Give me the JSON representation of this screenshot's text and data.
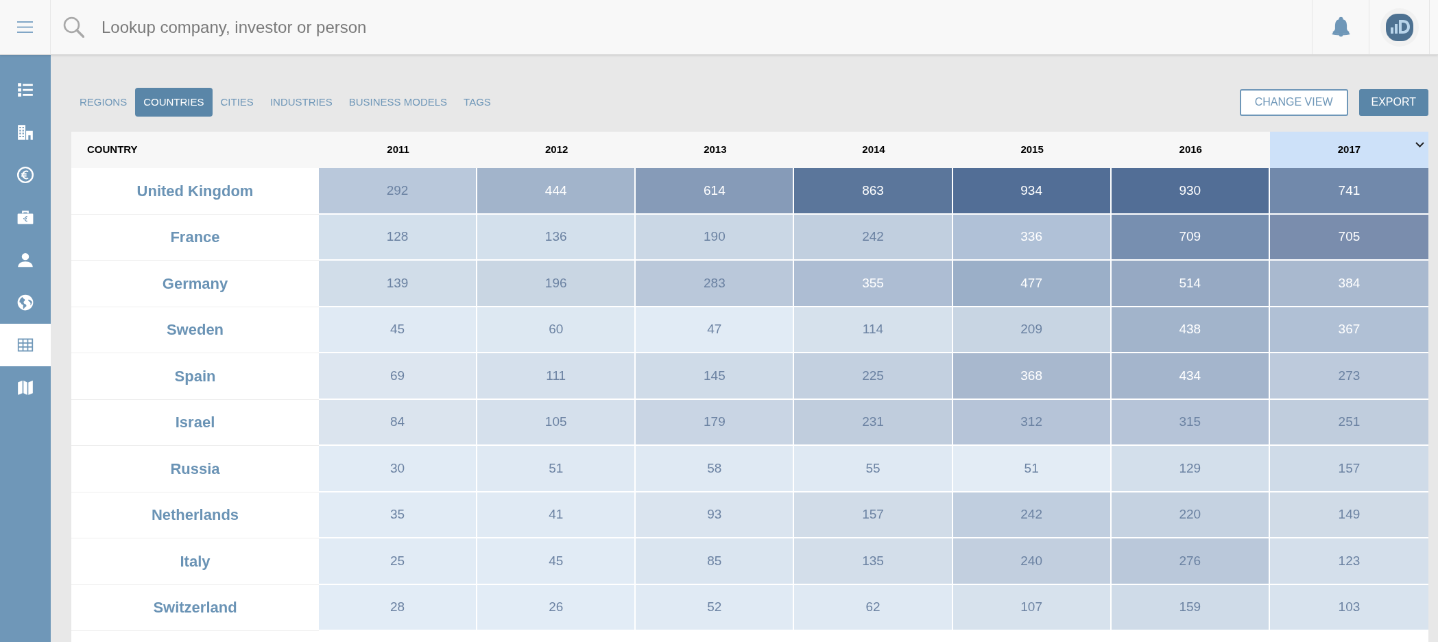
{
  "search": {
    "placeholder": "Lookup company, investor or person"
  },
  "sidebar": {
    "items": [
      {
        "selected": false
      },
      {
        "selected": false
      },
      {
        "selected": false
      },
      {
        "selected": false
      },
      {
        "selected": false
      },
      {
        "selected": false
      },
      {
        "selected": true
      },
      {
        "selected": false
      }
    ]
  },
  "tabs": [
    {
      "label": "REGIONS",
      "selected": false
    },
    {
      "label": "COUNTRIES",
      "selected": true
    },
    {
      "label": "CITIES",
      "selected": false
    },
    {
      "label": "INDUSTRIES",
      "selected": false
    },
    {
      "label": "BUSINESS MODELS",
      "selected": false
    },
    {
      "label": "TAGS",
      "selected": false
    }
  ],
  "buttons": [
    {
      "label": "CHANGE VIEW",
      "kind": "outline"
    },
    {
      "label": "EXPORT",
      "kind": "filled"
    }
  ],
  "table": {
    "columns": [
      {
        "label": "COUNTRY",
        "selected": false
      },
      {
        "label": "2011",
        "selected": false
      },
      {
        "label": "2012",
        "selected": false
      },
      {
        "label": "2013",
        "selected": false
      },
      {
        "label": "2014",
        "selected": false
      },
      {
        "label": "2015",
        "selected": false
      },
      {
        "label": "2016",
        "selected": false
      },
      {
        "label": "2017",
        "selected": true
      }
    ],
    "rows": [
      {
        "cells": [
          {
            "kind": "country",
            "value": "United Kingdom"
          },
          {
            "kind": "count",
            "value": "292",
            "color": "#b9c8db"
          },
          {
            "kind": "count",
            "value": "444",
            "color": "#a2b4cb"
          },
          {
            "kind": "count",
            "value": "614",
            "color": "#869bb8"
          },
          {
            "kind": "count",
            "value": "863",
            "color": "#5b769b"
          },
          {
            "kind": "count",
            "value": "934",
            "color": "#526e96"
          },
          {
            "kind": "count",
            "value": "930",
            "color": "#526e96"
          },
          {
            "kind": "count",
            "value": "741",
            "color": "#7189ab"
          }
        ]
      },
      {
        "cells": [
          {
            "kind": "country",
            "value": "France"
          },
          {
            "kind": "count",
            "value": "128",
            "color": "#d3e0ec"
          },
          {
            "kind": "count",
            "value": "136",
            "color": "#d3e0ec"
          },
          {
            "kind": "count",
            "value": "190",
            "color": "#cad7e5"
          },
          {
            "kind": "count",
            "value": "242",
            "color": "#c1cfdf"
          },
          {
            "kind": "count",
            "value": "336",
            "color": "#b0c1d7"
          },
          {
            "kind": "count",
            "value": "709",
            "color": "#778fb0"
          },
          {
            "kind": "count",
            "value": "705",
            "color": "#7a8dad"
          }
        ]
      },
      {
        "cells": [
          {
            "kind": "country",
            "value": "Germany"
          },
          {
            "kind": "count",
            "value": "139",
            "color": "#d1dde9"
          },
          {
            "kind": "count",
            "value": "196",
            "color": "#c9d6e3"
          },
          {
            "kind": "count",
            "value": "283",
            "color": "#bac8da"
          },
          {
            "kind": "count",
            "value": "355",
            "color": "#adbdd3"
          },
          {
            "kind": "count",
            "value": "477",
            "color": "#9bafc8"
          },
          {
            "kind": "count",
            "value": "514",
            "color": "#96a9c3"
          },
          {
            "kind": "count",
            "value": "384",
            "color": "#a9b9cf"
          }
        ]
      },
      {
        "cells": [
          {
            "kind": "country",
            "value": "Sweden"
          },
          {
            "kind": "count",
            "value": "45",
            "color": "#e0eaf4"
          },
          {
            "kind": "count",
            "value": "60",
            "color": "#dde8f2"
          },
          {
            "kind": "count",
            "value": "47",
            "color": "#e1ebf5"
          },
          {
            "kind": "count",
            "value": "114",
            "color": "#d6e1ec"
          },
          {
            "kind": "count",
            "value": "209",
            "color": "#c8d5e3"
          },
          {
            "kind": "count",
            "value": "438",
            "color": "#a2b4cb"
          },
          {
            "kind": "count",
            "value": "367",
            "color": "#b0c0d5"
          }
        ]
      },
      {
        "cells": [
          {
            "kind": "country",
            "value": "Spain"
          },
          {
            "kind": "count",
            "value": "69",
            "color": "#dde6f0"
          },
          {
            "kind": "count",
            "value": "111",
            "color": "#d5e0ec"
          },
          {
            "kind": "count",
            "value": "145",
            "color": "#cfdbe8"
          },
          {
            "kind": "count",
            "value": "225",
            "color": "#c3d0e0"
          },
          {
            "kind": "count",
            "value": "368",
            "color": "#a8b8ce"
          },
          {
            "kind": "count",
            "value": "434",
            "color": "#a4b5cc"
          },
          {
            "kind": "count",
            "value": "273",
            "color": "#bdcadc"
          }
        ]
      },
      {
        "cells": [
          {
            "kind": "country",
            "value": "Israel"
          },
          {
            "kind": "count",
            "value": "84",
            "color": "#dbe4ee"
          },
          {
            "kind": "count",
            "value": "105",
            "color": "#d5e0ec"
          },
          {
            "kind": "count",
            "value": "179",
            "color": "#c9d5e4"
          },
          {
            "kind": "count",
            "value": "231",
            "color": "#c0cddd"
          },
          {
            "kind": "count",
            "value": "312",
            "color": "#b6c4d8"
          },
          {
            "kind": "count",
            "value": "315",
            "color": "#b6c4d8"
          },
          {
            "kind": "count",
            "value": "251",
            "color": "#c0cddd"
          }
        ]
      },
      {
        "cells": [
          {
            "kind": "country",
            "value": "Russia"
          },
          {
            "kind": "count",
            "value": "30",
            "color": "#e1ebf5"
          },
          {
            "kind": "count",
            "value": "51",
            "color": "#dfe9f3"
          },
          {
            "kind": "count",
            "value": "58",
            "color": "#dfe9f3"
          },
          {
            "kind": "count",
            "value": "55",
            "color": "#dfe9f3"
          },
          {
            "kind": "count",
            "value": "51",
            "color": "#e3ecf5"
          },
          {
            "kind": "count",
            "value": "129",
            "color": "#d3dfeb"
          },
          {
            "kind": "count",
            "value": "157",
            "color": "#cfdbe8"
          }
        ]
      },
      {
        "cells": [
          {
            "kind": "country",
            "value": "Netherlands"
          },
          {
            "kind": "count",
            "value": "35",
            "color": "#e1ebf5"
          },
          {
            "kind": "count",
            "value": "41",
            "color": "#e0eaf4"
          },
          {
            "kind": "count",
            "value": "93",
            "color": "#dae4ef"
          },
          {
            "kind": "count",
            "value": "157",
            "color": "#d1dce8"
          },
          {
            "kind": "count",
            "value": "242",
            "color": "#c0cedf"
          },
          {
            "kind": "count",
            "value": "220",
            "color": "#c5d2e1"
          },
          {
            "kind": "count",
            "value": "149",
            "color": "#d0dbe7"
          }
        ]
      },
      {
        "cells": [
          {
            "kind": "country",
            "value": "Italy"
          },
          {
            "kind": "count",
            "value": "25",
            "color": "#e1ebf5"
          },
          {
            "kind": "count",
            "value": "45",
            "color": "#e1ebf5"
          },
          {
            "kind": "count",
            "value": "85",
            "color": "#dae5f0"
          },
          {
            "kind": "count",
            "value": "135",
            "color": "#d3deea"
          },
          {
            "kind": "count",
            "value": "240",
            "color": "#c2cfdf"
          },
          {
            "kind": "count",
            "value": "276",
            "color": "#bac8da"
          },
          {
            "kind": "count",
            "value": "123",
            "color": "#d4dfeb"
          }
        ]
      },
      {
        "cells": [
          {
            "kind": "country",
            "value": "Switzerland"
          },
          {
            "kind": "count",
            "value": "28",
            "color": "#e2ecf6"
          },
          {
            "kind": "count",
            "value": "26",
            "color": "#e2ecf6"
          },
          {
            "kind": "count",
            "value": "52",
            "color": "#e0eaf4"
          },
          {
            "kind": "count",
            "value": "62",
            "color": "#dfe9f3"
          },
          {
            "kind": "count",
            "value": "107",
            "color": "#d7e2ed"
          },
          {
            "kind": "count",
            "value": "159",
            "color": "#cfdbe8"
          },
          {
            "kind": "count",
            "value": "103",
            "color": "#d8e3ee"
          }
        ]
      }
    ]
  }
}
